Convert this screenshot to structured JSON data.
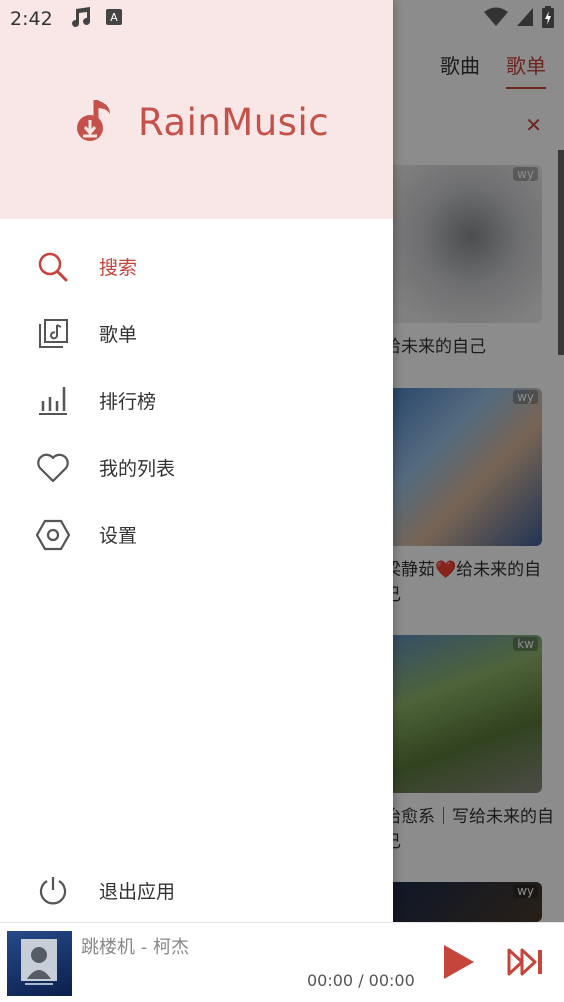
{
  "status": {
    "time": "2:42"
  },
  "background": {
    "tabs": [
      "歌曲",
      "歌单"
    ],
    "active_tab": "歌单",
    "cards": [
      {
        "badge": "wy",
        "title": "给未来的自己"
      },
      {
        "badge": "wy",
        "title": "梁静茹❤️给未来的自己"
      },
      {
        "badge": "kw",
        "title": "治愈系｜写给未来的自己"
      },
      {
        "badge": "wy",
        "title": ""
      }
    ]
  },
  "drawer": {
    "brand": "RainMusic",
    "menu": [
      {
        "label": "搜索",
        "icon": "search-icon"
      },
      {
        "label": "歌单",
        "icon": "playlist-icon"
      },
      {
        "label": "排行榜",
        "icon": "chart-bars-icon"
      },
      {
        "label": "我的列表",
        "icon": "heart-icon"
      },
      {
        "label": "设置",
        "icon": "hexagon-settings-icon"
      }
    ],
    "exit": {
      "label": "退出应用",
      "icon": "power-icon"
    }
  },
  "player": {
    "song": "跳楼机 - 柯杰",
    "time": "00:00 / 00:00"
  },
  "colors": {
    "accent": "#c5443b",
    "header_bg": "#f8e7e6"
  }
}
